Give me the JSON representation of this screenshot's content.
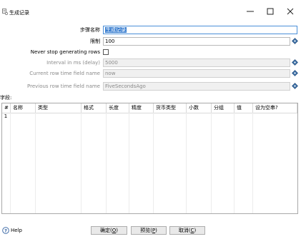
{
  "window": {
    "title": "生成记录"
  },
  "form": {
    "step_name_label": "步骤名称",
    "step_name_value": "生成记录",
    "limit_label": "限制",
    "limit_value": "100",
    "never_stop_label": "Never stop generating rows",
    "never_stop_checked": false,
    "interval_label": "Interval in ms (delay)",
    "interval_value": "5000",
    "current_time_label": "Current row time field name",
    "current_time_value": "now",
    "previous_time_label": "Previous row time field name",
    "previous_time_value": "FiveSecondsAgo"
  },
  "fields_label": "字段:",
  "table": {
    "columns": [
      "#",
      "名称",
      "类型",
      "格式",
      "长度",
      "精度",
      "货币类型",
      "小数",
      "分组",
      "值",
      "设为空串?"
    ],
    "rows": [
      [
        "1",
        "",
        "",
        "",
        "",
        "",
        "",
        "",
        "",
        "",
        ""
      ]
    ]
  },
  "footer": {
    "help_label": "Help",
    "ok_label_main": "确定(",
    "ok_key": "O",
    "ok_close": ")",
    "preview_label_main": "预览(",
    "preview_key": "P",
    "preview_close": ")",
    "cancel_label_main": "取消(",
    "cancel_key": "C",
    "cancel_close": ")"
  },
  "colors": {
    "accent": "#3b7fd0",
    "diamond": "#3a6ea5"
  }
}
